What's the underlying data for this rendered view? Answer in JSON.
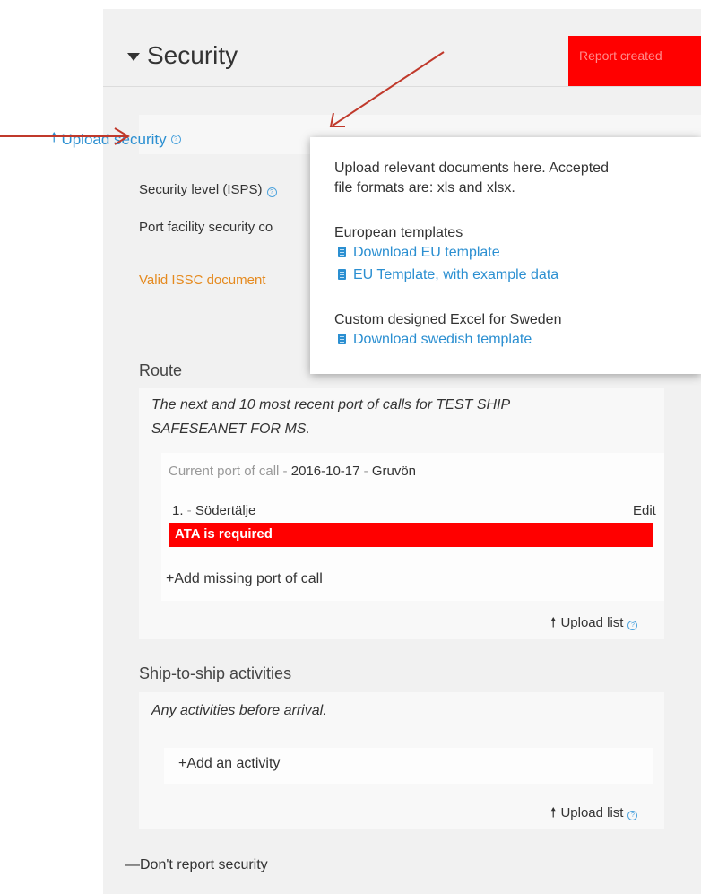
{
  "header": {
    "title": "Security",
    "badge": "Report created"
  },
  "upload_security": {
    "label": "Upload security"
  },
  "fields": {
    "security_level": "Security level (ISPS)",
    "port_facility": "Port facility security co",
    "issc": "Valid ISSC document"
  },
  "tooltip": {
    "line1": "Upload relevant documents here. Accepted",
    "line2": "file formats are: xls and xlsx.",
    "eu_heading": "European templates",
    "download_eu": "Download EU template",
    "eu_example": "EU Template, with example data",
    "custom_heading": "Custom designed Excel for Sweden",
    "download_swedish": "Download swedish template"
  },
  "route": {
    "title": "Route",
    "desc_line1": "The next and 10 most recent port of calls for TEST SHIP",
    "desc_line2": "SAFESEANET FOR MS.",
    "current_label": "Current port of call",
    "current_sep": " - ",
    "current_date": "2016-10-17",
    "current_sep2": " - ",
    "current_port": "Gruvön",
    "port_number": "1.",
    "port_sep": " - ",
    "port_name": "Södertälje",
    "edit": "Edit",
    "error": "ATA is required",
    "add_missing": "+Add missing port of call",
    "upload_list": "Upload list"
  },
  "sts": {
    "title": "Ship-to-ship activities",
    "desc": "Any activities before arrival.",
    "add_activity": "+Add an activity",
    "upload_list": "Upload list"
  },
  "footer": {
    "dont_report": "—Don't report security"
  },
  "colors": {
    "accent": "#2b8fd1",
    "error": "#ff0000",
    "warning": "#e58a1f",
    "annotation_arrow": "#c0392b"
  }
}
